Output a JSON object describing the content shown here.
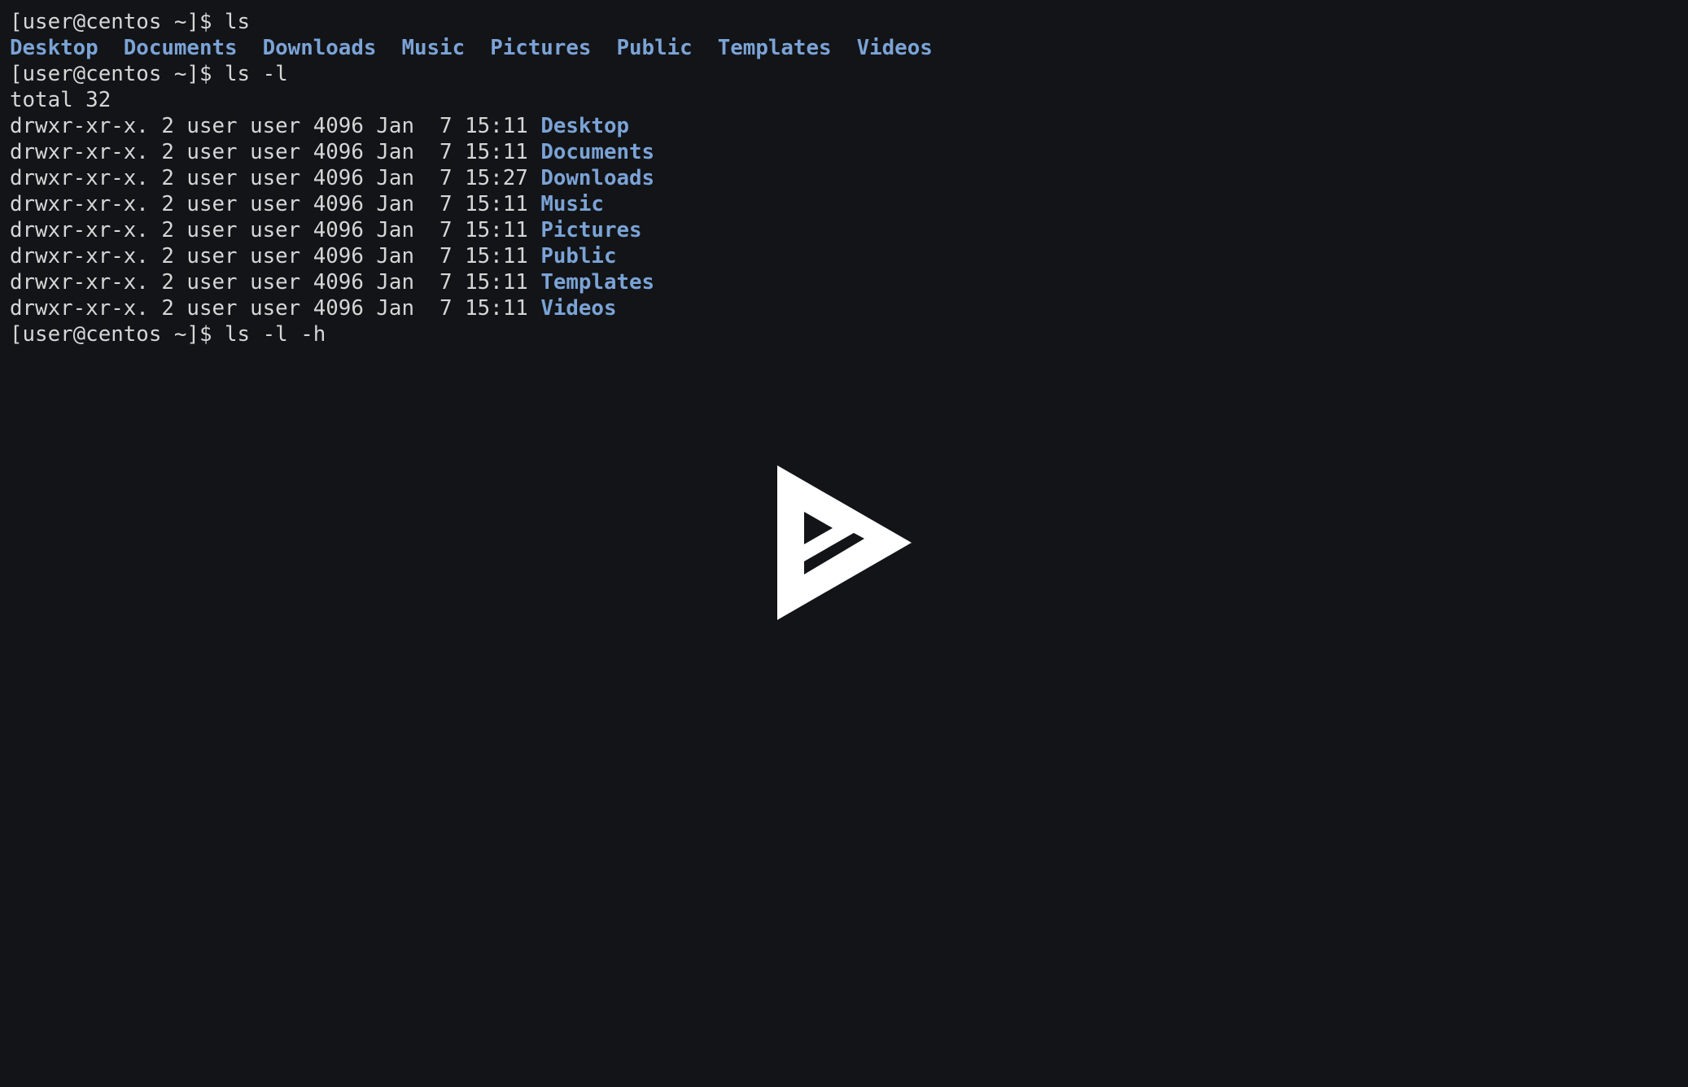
{
  "terminal": {
    "prompt": "[user@centos ~]$ ",
    "commands": [
      "ls",
      "ls -l",
      "ls -l -h"
    ],
    "ls_output": [
      "Desktop",
      "Documents",
      "Downloads",
      "Music",
      "Pictures",
      "Public",
      "Templates",
      "Videos"
    ],
    "total_line": "total 32",
    "ls_l_rows": [
      {
        "meta": "drwxr-xr-x. 2 user user 4096 Jan  7 15:11 ",
        "name": "Desktop"
      },
      {
        "meta": "drwxr-xr-x. 2 user user 4096 Jan  7 15:11 ",
        "name": "Documents"
      },
      {
        "meta": "drwxr-xr-x. 2 user user 4096 Jan  7 15:27 ",
        "name": "Downloads"
      },
      {
        "meta": "drwxr-xr-x. 2 user user 4096 Jan  7 15:11 ",
        "name": "Music"
      },
      {
        "meta": "drwxr-xr-x. 2 user user 4096 Jan  7 15:11 ",
        "name": "Pictures"
      },
      {
        "meta": "drwxr-xr-x. 2 user user 4096 Jan  7 15:11 ",
        "name": "Public"
      },
      {
        "meta": "drwxr-xr-x. 2 user user 4096 Jan  7 15:11 ",
        "name": "Templates"
      },
      {
        "meta": "drwxr-xr-x. 2 user user 4096 Jan  7 15:11 ",
        "name": "Videos"
      }
    ]
  },
  "overlay": {
    "icon": "asciinema-play-icon"
  },
  "colors": {
    "background": "#121417",
    "text": "#d6d6d6",
    "directory": "#7ba3d6",
    "icon": "#ffffff"
  }
}
